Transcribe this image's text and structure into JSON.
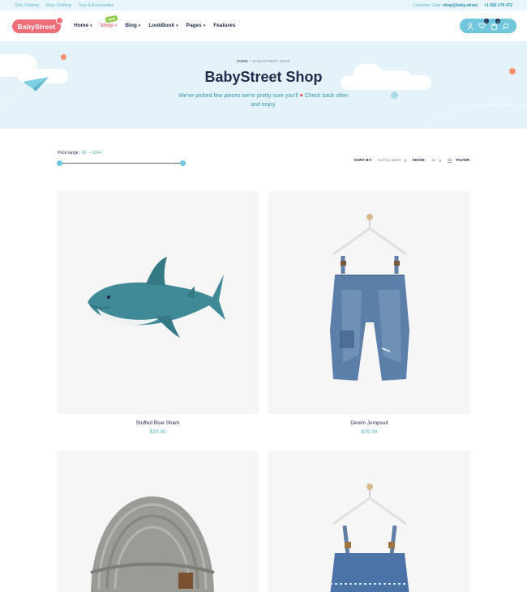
{
  "topbar": {
    "links": [
      "Girls Clothing",
      "Boys Clothing",
      "Toys & Accessories"
    ],
    "customer_care_label": "Customer Care:",
    "email": "shop@baby.street",
    "phone": "+1 555 179 472"
  },
  "header": {
    "logo_text": "BabyStreet",
    "nav": [
      {
        "label": "Home",
        "dropdown": true,
        "active": false
      },
      {
        "label": "Shop",
        "dropdown": true,
        "active": true,
        "badge": "NEW"
      },
      {
        "label": "Blog",
        "dropdown": true,
        "active": false
      },
      {
        "label": "LookBook",
        "dropdown": true,
        "active": false
      },
      {
        "label": "Pages",
        "dropdown": true,
        "active": false
      },
      {
        "label": "Features",
        "dropdown": false,
        "active": false
      }
    ],
    "wishlist_count": "1",
    "cart_count": "0",
    "icons": [
      "user-icon",
      "heart-icon",
      "bag-icon",
      "search-icon"
    ]
  },
  "hero": {
    "breadcrumb_home": "HOME",
    "breadcrumb_sep": "/",
    "breadcrumb_current": "BABYSTREET SHOP",
    "title": "BabyStreet Shop",
    "subtitle_part1": "We've picked few pieces we're pretty sure you'll",
    "subtitle_heart": "♥",
    "subtitle_part2": "Check back often and enjoy."
  },
  "filters": {
    "price_label": "Price range:",
    "price_value": "$6 — $144",
    "price_min_fraction": 0.0,
    "price_max_fraction": 1.0,
    "sort_label": "SORT BY:",
    "sort_value": "Sort by latest",
    "show_label": "SHOW:",
    "show_value": "12",
    "filter_label": "FILTER"
  },
  "products": [
    {
      "name": "Stuffed Blue Shark",
      "price": "$39.99"
    },
    {
      "name": "Denim Jumpsuit",
      "price": "$39.99"
    },
    {
      "name": "",
      "price": ""
    },
    {
      "name": "",
      "price": ""
    }
  ],
  "colors": {
    "accent_pink": "#f06d7a",
    "accent_blue": "#6fc6dd",
    "text_dark": "#1f2a4d",
    "hero_bg": "#e4f3f9"
  }
}
